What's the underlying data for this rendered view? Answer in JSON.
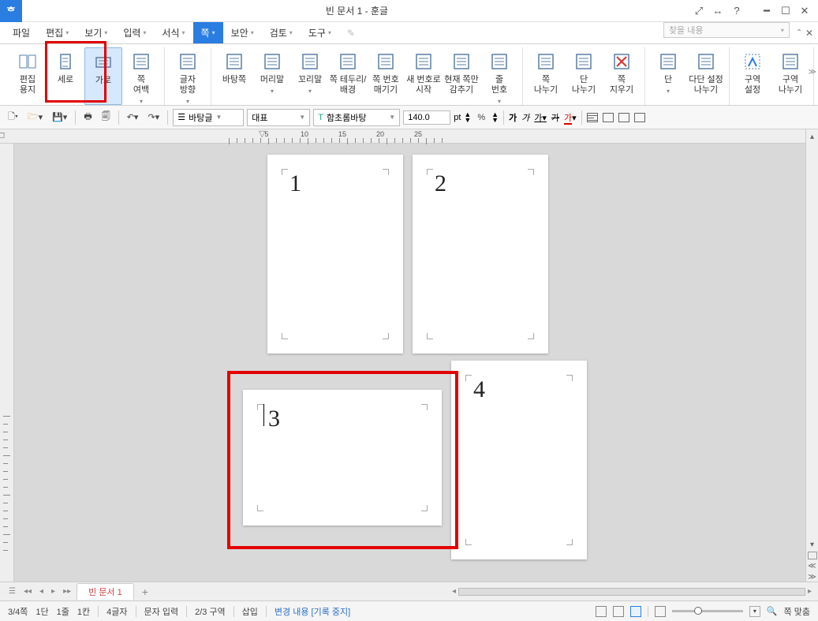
{
  "title": "빈 문서 1 - 훈글",
  "logo": "ᄒ",
  "menus": [
    {
      "label": "파일",
      "dd": false
    },
    {
      "label": "편집",
      "dd": true
    },
    {
      "label": "보기",
      "dd": true
    },
    {
      "label": "입력",
      "dd": true
    },
    {
      "label": "서식",
      "dd": true
    },
    {
      "label": "쪽",
      "dd": true,
      "active": true
    },
    {
      "label": "보안",
      "dd": true
    },
    {
      "label": "검토",
      "dd": true
    },
    {
      "label": "도구",
      "dd": true
    }
  ],
  "search_placeholder": "찾을 내용",
  "ribbon": [
    {
      "label": "편집\n용지",
      "icon": "page-dual"
    },
    {
      "label": "세로",
      "icon": "page-portrait",
      "highlighted": true
    },
    {
      "label": "가로",
      "icon": "page-landscape",
      "selected": true,
      "highlighted": true
    },
    {
      "label": "쪽\n여백",
      "icon": "page-margin",
      "dd": true
    },
    {
      "label": "글자\n방향",
      "icon": "text-dir",
      "dd": true,
      "newgroup": true
    },
    {
      "label": "바탕쪽",
      "icon": "bg-page",
      "newgroup": true
    },
    {
      "label": "머리말",
      "icon": "header",
      "dd": true
    },
    {
      "label": "꼬리말",
      "icon": "footer",
      "dd": true
    },
    {
      "label": "쪽 테두리/\n배경",
      "icon": "border"
    },
    {
      "label": "쪽 번호\n매기기",
      "icon": "pagenum"
    },
    {
      "label": "새 번호로\n시작",
      "icon": "newnum"
    },
    {
      "label": "현재 쪽만\n감추기",
      "icon": "hide"
    },
    {
      "label": "줄\n번호",
      "icon": "linenum",
      "dd": true
    },
    {
      "label": "쪽\n나누기",
      "icon": "pagebreak",
      "newgroup": true
    },
    {
      "label": "단\n나누기",
      "icon": "colbreak"
    },
    {
      "label": "쪽\n지우기",
      "icon": "pagedel"
    },
    {
      "label": "단",
      "icon": "column",
      "dd": true,
      "newgroup": true
    },
    {
      "label": "다단 설정\n나누기",
      "icon": "multicol"
    },
    {
      "label": "구역\n설정",
      "icon": "section",
      "newgroup": true
    },
    {
      "label": "구역\n나누기",
      "icon": "sectionbreak"
    }
  ],
  "quickbar": {
    "style": "바탕글",
    "rep": "대표",
    "font": "함초롬바탕",
    "size": "140.0",
    "unit": "pt",
    "pct": "%"
  },
  "ruler_nums": [
    "5",
    "10",
    "15",
    "20",
    "25"
  ],
  "pages": [
    {
      "num": "1"
    },
    {
      "num": "2"
    },
    {
      "num": "3"
    },
    {
      "num": "4"
    }
  ],
  "tab_label": "빈 문서 1",
  "status": {
    "page": "3/4쪽",
    "dan": "1단",
    "line": "1줄",
    "col": "1칸",
    "chars": "4글자",
    "mode": "문자 입력",
    "section": "2/3 구역",
    "insert": "삽입",
    "change": "변경 내용 [기록 중지]",
    "zoom": "쪽 맞춤"
  },
  "fmt_chars": {
    "bold": "가",
    "italic": "가",
    "underline": "가",
    "strike": "가",
    "color": "가"
  }
}
